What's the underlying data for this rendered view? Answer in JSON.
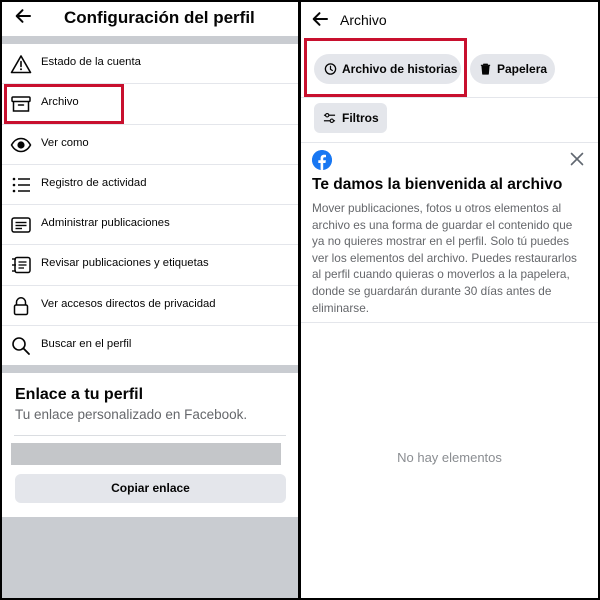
{
  "left": {
    "header": {
      "title": "Configuración del perfil"
    },
    "menu": [
      {
        "label": "Estado de la cuenta",
        "icon": "warning-icon"
      },
      {
        "label": "Archivo",
        "icon": "archive-box-icon"
      },
      {
        "label": "Ver como",
        "icon": "eye-icon"
      },
      {
        "label": "Registro de actividad",
        "icon": "list-icon"
      },
      {
        "label": "Administrar publicaciones",
        "icon": "manage-posts-icon"
      },
      {
        "label": "Revisar publicaciones y etiquetas",
        "icon": "review-tags-icon"
      },
      {
        "label": "Ver accesos directos de privacidad",
        "icon": "lock-icon"
      },
      {
        "label": "Buscar en el perfil",
        "icon": "search-icon"
      }
    ],
    "profile_link": {
      "title": "Enlace a tu perfil",
      "subtitle": "Tu enlace personalizado en Facebook.",
      "copy_button": "Copiar enlace"
    }
  },
  "right": {
    "header": {
      "title": "Archivo"
    },
    "chips": {
      "stories": "Archivo de historias",
      "trash": "Papelera",
      "filters": "Filtros"
    },
    "welcome": {
      "title": "Te damos la bienvenida al archivo",
      "body": "Mover publicaciones, fotos u otros elementos al archivo es una forma de guardar el contenido que ya no quieres mostrar en el perfil. Solo tú puedes ver los elementos del archivo. Puedes restaurarlos al perfil cuando quieras o moverlos a la papelera, donde se guardarán durante 30 días antes de eliminarse."
    },
    "empty_state": "No hay elementos"
  },
  "colors": {
    "highlight": "#c8102e",
    "facebook_blue": "#1877f2",
    "chip_bg": "#e4e6eb",
    "gray_band": "#c9ccd1"
  }
}
